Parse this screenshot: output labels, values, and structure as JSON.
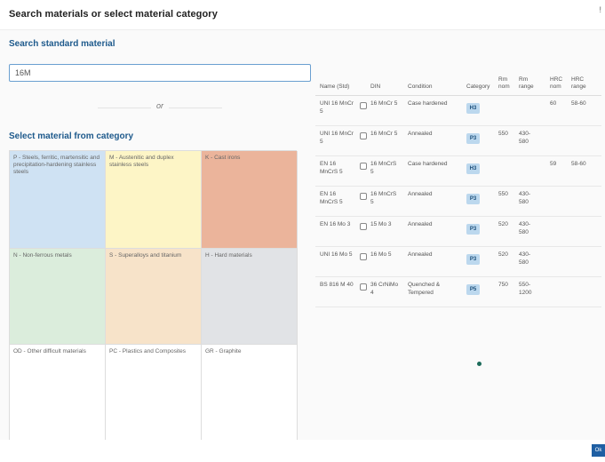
{
  "header": {
    "title": "Search materials or select material category",
    "close": "!"
  },
  "search": {
    "title": "Search standard material",
    "value": "16M"
  },
  "or_label": "or",
  "category": {
    "title": "Select material from category",
    "cells": [
      "P - Steels, ferritic, martensitic and precipitation-hardening stainless steels",
      "M - Austenitic and duplex stainless steels",
      "K - Cast irons",
      "N - Non-ferrous metals",
      "S - Superalloys and titanium",
      "H - Hard materials",
      "OD - Other difficult materials",
      "PC - Plastics and Composites",
      "GR - Graphite"
    ]
  },
  "table": {
    "headers": {
      "name": "Name (Std)",
      "din": "DIN",
      "condition": "Condition",
      "category": "Category",
      "rm_nom": "Rm nom",
      "rm_range": "Rm range",
      "hrc_nom": "HRC nom",
      "hrc_range": "HRC range"
    },
    "rows": [
      {
        "name": "UNI 16 MnCr 5",
        "din": "16 MnCr 5",
        "condition": "Case hardened",
        "category": "H3",
        "rm_nom": "",
        "rm_range": "",
        "hrc_nom": "60",
        "hrc_range": "58-60"
      },
      {
        "name": "UNI 16 MnCr 5",
        "din": "16 MnCr 5",
        "condition": "Annealed",
        "category": "P3",
        "rm_nom": "550",
        "rm_range": "430-580",
        "hrc_nom": "",
        "hrc_range": ""
      },
      {
        "name": "EN 16 MnCrS 5",
        "din": "16 MnCrS 5",
        "condition": "Case hardened",
        "category": "H3",
        "rm_nom": "",
        "rm_range": "",
        "hrc_nom": "59",
        "hrc_range": "58-60"
      },
      {
        "name": "EN 16 MnCrS 5",
        "din": "16 MnCrS 5",
        "condition": "Annealed",
        "category": "P3",
        "rm_nom": "550",
        "rm_range": "430-580",
        "hrc_nom": "",
        "hrc_range": ""
      },
      {
        "name": "EN 16 Mo 3",
        "din": "15 Mo 3",
        "condition": "Annealed",
        "category": "P3",
        "rm_nom": "520",
        "rm_range": "430-580",
        "hrc_nom": "",
        "hrc_range": ""
      },
      {
        "name": "UNI 16 Mo 5",
        "din": "16 Mo 5",
        "condition": "Annealed",
        "category": "P3",
        "rm_nom": "520",
        "rm_range": "430-580",
        "hrc_nom": "",
        "hrc_range": ""
      },
      {
        "name": "BS 816 M 40",
        "din": "36 CrNiMo 4",
        "condition": "Quenched & Tempered",
        "category": "P5",
        "rm_nom": "750",
        "rm_range": "550-1200",
        "hrc_nom": "",
        "hrc_range": ""
      }
    ]
  },
  "footer": {
    "ok": "Ok"
  }
}
